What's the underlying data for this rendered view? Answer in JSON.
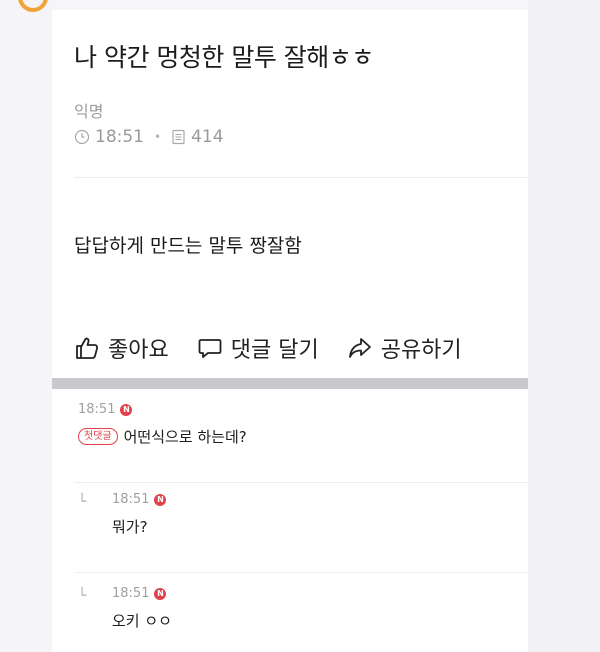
{
  "post": {
    "title": "나 약간 멍청한 말투 잘해ㅎㅎ",
    "author": "익명",
    "time": "18:51",
    "views": "414",
    "body": "답답하게 만드는 말투 짱잘함"
  },
  "actions": {
    "like_label": "좋아요",
    "comment_label": "댓글 달기",
    "share_label": "공유하기"
  },
  "comments": [
    {
      "time": "18:51",
      "badge": "N",
      "tag": "첫댓글",
      "text": "어떤식으로 하는데?"
    },
    {
      "time": "18:51",
      "badge": "N",
      "text": "뭐가?",
      "reply": true
    },
    {
      "time": "18:51",
      "badge": "N",
      "text": "오키 ㅇㅇ",
      "reply": true
    }
  ],
  "colors": {
    "accent_red": "#e2414a",
    "divider_gray": "#c9c9cd"
  }
}
